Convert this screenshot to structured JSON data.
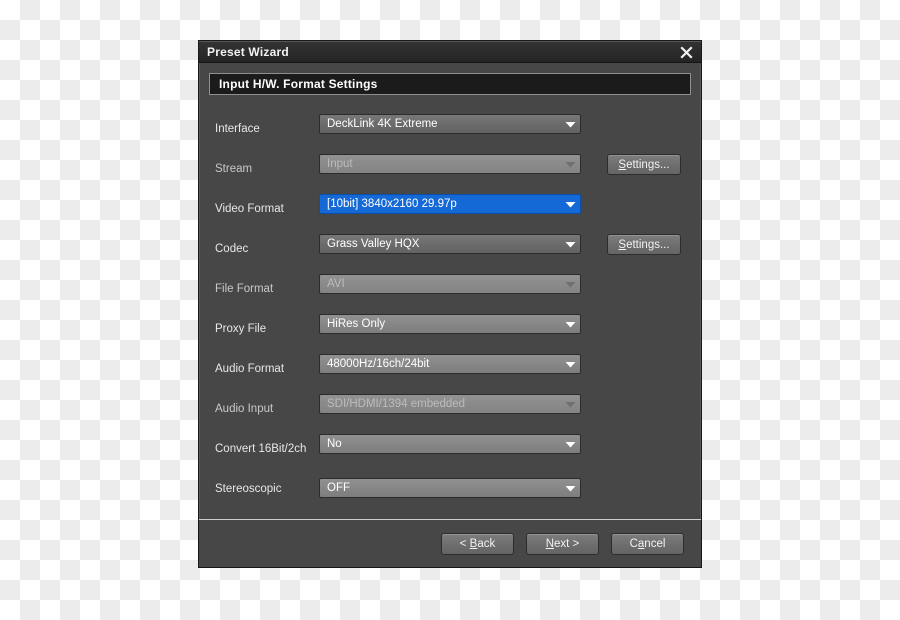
{
  "window": {
    "title": "Preset Wizard",
    "close_icon": "close-icon"
  },
  "section": {
    "header": "Input H/W. Format Settings"
  },
  "colors": {
    "dialog_background": "#474747",
    "titlebar": "#2b2b2b",
    "section_header_background": "#1b1b1b",
    "combo_enabled": "#6c6c6c",
    "combo_light": "#878787",
    "combo_disabled": "#8a8a8a",
    "combo_selected": "#1569d6",
    "text": "#ffffff",
    "text_disabled": "#bcbcbc"
  },
  "form": {
    "rows": [
      {
        "label": "Interface",
        "value": "DeckLink 4K Extreme",
        "state": "enabled",
        "has_settings": false
      },
      {
        "label": "Stream",
        "value": "Input",
        "state": "disabled",
        "has_settings": true,
        "settings_label_pre": "S",
        "settings_label_post": "ettings..."
      },
      {
        "label": "Video Format",
        "value": "[10bit] 3840x2160 29.97p",
        "state": "selected",
        "has_settings": false
      },
      {
        "label": "Codec",
        "value": "Grass Valley HQX",
        "state": "enabled",
        "has_settings": true,
        "settings_label_pre": "S",
        "settings_label_post": "ettings..."
      },
      {
        "label": "File Format",
        "value": "AVI",
        "state": "disabled",
        "has_settings": false
      },
      {
        "label": "Proxy File",
        "value": "HiRes Only",
        "state": "light",
        "has_settings": false
      },
      {
        "label": "Audio Format",
        "value": "48000Hz/16ch/24bit",
        "state": "light",
        "has_settings": false
      },
      {
        "label": "Audio Input",
        "value": "SDI/HDMI/1394 embedded",
        "state": "disabled",
        "has_settings": false
      },
      {
        "label": "Convert 16Bit/2ch",
        "value": "No",
        "state": "light",
        "has_settings": false
      },
      {
        "label": "Stereoscopic",
        "value": "OFF",
        "state": "light",
        "has_settings": false
      }
    ]
  },
  "footer": {
    "buttons": [
      {
        "name": "back-button",
        "pre": "< ",
        "accel": "B",
        "post": "ack"
      },
      {
        "name": "next-button",
        "pre": "",
        "accel": "N",
        "post": "ext >"
      },
      {
        "name": "cancel-button",
        "pre": "C",
        "accel": "a",
        "post": "ncel"
      }
    ]
  }
}
